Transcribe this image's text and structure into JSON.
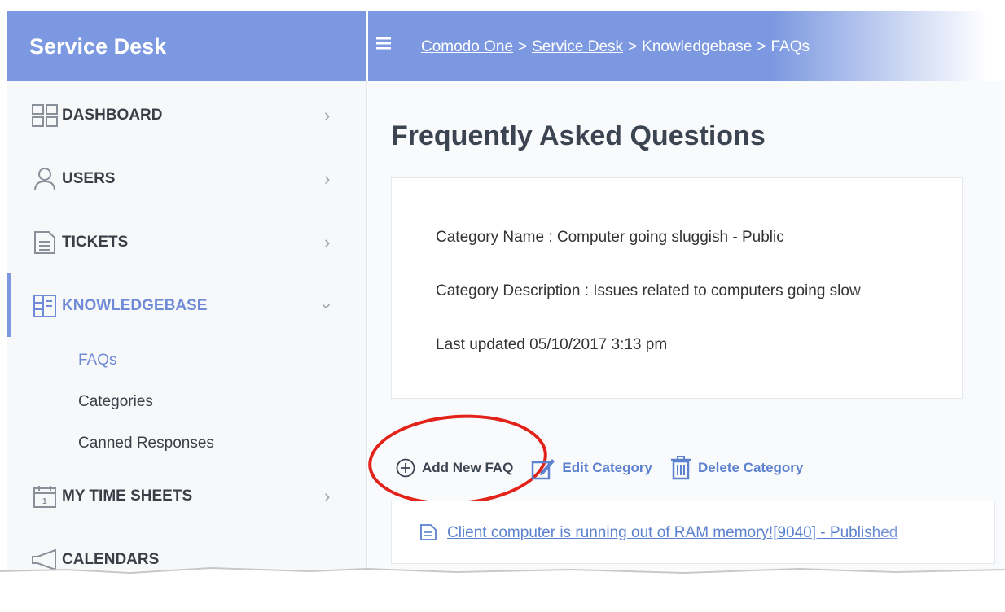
{
  "app_title": "Service Desk",
  "breadcrumb": {
    "items": [
      "Comodo One",
      "Service Desk",
      "Knowledgebase",
      "FAQs"
    ],
    "separator": ">"
  },
  "sidebar": {
    "items": [
      {
        "label": "DASHBOARD",
        "icon": "dashboard-grid-icon"
      },
      {
        "label": "USERS",
        "icon": "user-icon"
      },
      {
        "label": "TICKETS",
        "icon": "ticket-document-icon"
      },
      {
        "label": "KNOWLEDGEBASE",
        "icon": "knowledgebase-icon"
      },
      {
        "label": "MY TIME SHEETS",
        "icon": "calendar-icon"
      },
      {
        "label": "CALENDARS",
        "icon": "megaphone-icon"
      }
    ],
    "subitems": [
      "FAQs",
      "Categories",
      "Canned Responses"
    ]
  },
  "main": {
    "title": "Frequently Asked Questions",
    "category_name": "Category Name : Computer going sluggish - Public",
    "category_description": "Category Description : Issues related to computers going slow",
    "last_updated": "Last updated 05/10/2017 3:13 pm",
    "actions": {
      "add_new_faq": "Add New FAQ",
      "edit_category": "Edit Category",
      "delete_category": "Delete Category"
    },
    "faqs": [
      "Client computer is running out of RAM memory![9040] - Published"
    ]
  },
  "colors": {
    "header_blue": "#7b98e0",
    "link_blue": "#5c82cf",
    "highlight_red": "#e2231a"
  }
}
